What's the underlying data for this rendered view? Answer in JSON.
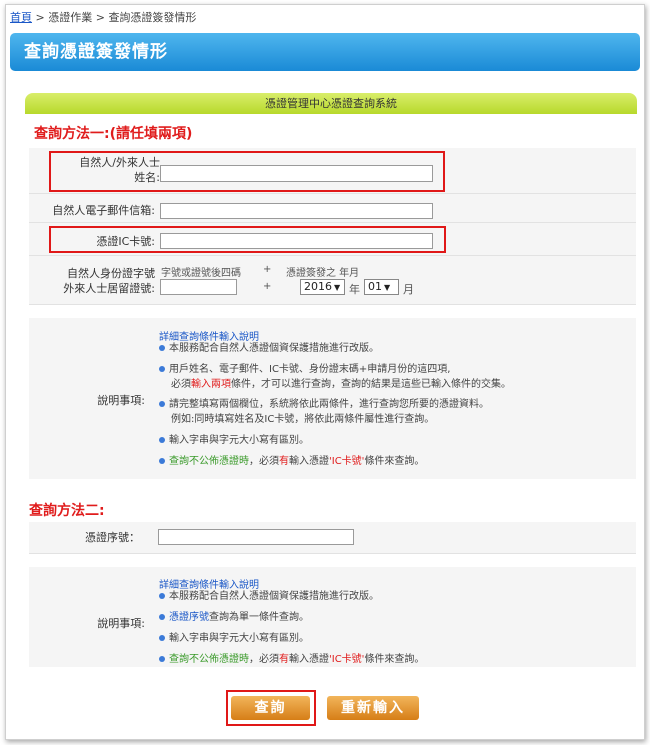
{
  "breadcrumb": {
    "home": "首頁",
    "sep1": " > ",
    "section": "憑證作業",
    "sep2": " > ",
    "current": "查詢憑證簽發情形"
  },
  "page_title": "查詢憑證簽發情形",
  "system_title": "憑證管理中心憑證查詢系統",
  "method1": {
    "title": "查詢方法一:(請任填兩項)",
    "name_label_1": "自然人/外來人士",
    "name_label_2": "姓名:",
    "email_label": "自然人電子郵件信箱:",
    "ic_label": "憑證IC卡號:",
    "id_label_1": "自然人身份證字號",
    "id_label_2": "外來人士居留證號:",
    "id_hint": "字號或證號後四碼",
    "plus": "+",
    "date_hint": "憑證簽發之 年月",
    "year_value": "2016",
    "year_unit": "年",
    "month_value": "01",
    "month_unit": "月",
    "notes_label": "說明事項:",
    "notes_title": "詳細查詢條件輸入說明",
    "note1": "本服務配合自然人憑證個資保護措施進行改版。",
    "note2a": "用戶姓名、電子郵件、IC卡號、身份證末碼+申請月份的這四項,",
    "note2b_1": "必須",
    "note2b_2": "輸入兩項",
    "note2b_3": "條件，才可以進行查詢，查詢的結果是這些已輸入條件的交集。",
    "note3a": "請完整填寫兩個欄位，系統將依此兩條件，進行查詢您所要的憑證資料。",
    "note3b": "例如:同時填寫姓名及IC卡號，將依此兩條件屬性進行查詢。",
    "note4": "輸入字串與字元大小寫有區別。",
    "note5_1": "查詢不公佈憑證時",
    "note5_2": "，必須",
    "note5_3": "有",
    "note5_4": "輸入憑證",
    "note5_5": "'IC卡號'",
    "note5_6": "條件來查詢。"
  },
  "method2": {
    "title": "查詢方法二:",
    "serial_label": "憑證序號：",
    "notes_label": "說明事項:",
    "notes_title": "詳細查詢條件輸入說明",
    "note1": "本服務配合自然人憑證個資保護措施進行改版。",
    "note2_1": "憑證序號",
    "note2_2": "查詢為單一條件查詢。",
    "note3": "輸入字串與字元大小寫有區別。",
    "note4_1": "查詢不公佈憑證時",
    "note4_2": "，必須",
    "note4_3": "有",
    "note4_4": "輸入憑證",
    "note4_5": "'IC卡號'",
    "note4_6": "條件來查詢。"
  },
  "buttons": {
    "query": "查詢",
    "reset": "重新輸入"
  },
  "colors": {
    "accent_red": "#e01c1c",
    "title_blue": "#1a8ad6",
    "header_green": "#b7d92b",
    "button_orange": "#d67e17"
  }
}
